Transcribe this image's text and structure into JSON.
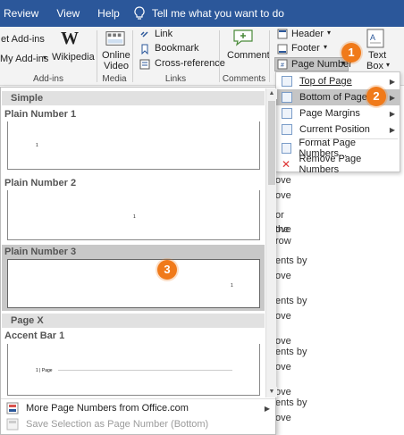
{
  "menubar": {
    "items": [
      "Review",
      "View",
      "Help"
    ],
    "tell_me": "Tell me what you want to do"
  },
  "ribbon": {
    "addins": {
      "get_addins": "et Add-ins",
      "my_addins": "My Add-ins",
      "wikipedia": "Wikipedia",
      "label": "Add-ins"
    },
    "media": {
      "online_video_1": "Online",
      "online_video_2": "Video",
      "label": "Media"
    },
    "links": {
      "link": "Link",
      "bookmark": "Bookmark",
      "cross_reference": "Cross-reference",
      "label": "Links"
    },
    "comments": {
      "comment": "Comment",
      "label": "Comments"
    },
    "header_footer": {
      "header": "Header",
      "footer": "Footer",
      "page_number": "Page Number"
    },
    "text": {
      "text_box_1": "Text",
      "text_box_2": "Box"
    }
  },
  "page_number_menu": {
    "items": [
      {
        "label": "Top of Page",
        "has_sub": true
      },
      {
        "label": "Bottom of Page",
        "has_sub": true
      },
      {
        "label": "Page Margins",
        "has_sub": true
      },
      {
        "label": "Current Position",
        "has_sub": true
      },
      {
        "label": "Format Page Numbers...",
        "has_sub": false
      },
      {
        "label": "Remove Page Numbers",
        "has_sub": false
      }
    ]
  },
  "gallery": {
    "section_simple": "Simple",
    "items": [
      {
        "title": "Plain Number 1",
        "num": "1"
      },
      {
        "title": "Plain Number 2",
        "num": "1"
      },
      {
        "title": "Plain Number 3",
        "num": "1"
      }
    ],
    "section_pagex": "Page X",
    "accent_bar_title": "Accent Bar 1",
    "accent_bar_text": "1 | Page",
    "more": "More Page Numbers from Office.com",
    "save_selection": "Save Selection as Page Number (Bottom)"
  },
  "document_text": [
    "ove",
    "ove",
    "ove",
    "or",
    "the",
    "row",
    "ents by",
    "ove",
    "ents by",
    "ove",
    "ove",
    "ents by",
    "ove",
    "ove",
    "ents by",
    "ove"
  ],
  "callouts": [
    "1",
    "2",
    "3"
  ],
  "colors": {
    "accent": "#2b579a",
    "callout": "#f07a1a",
    "selected": "#c8c8c8"
  }
}
